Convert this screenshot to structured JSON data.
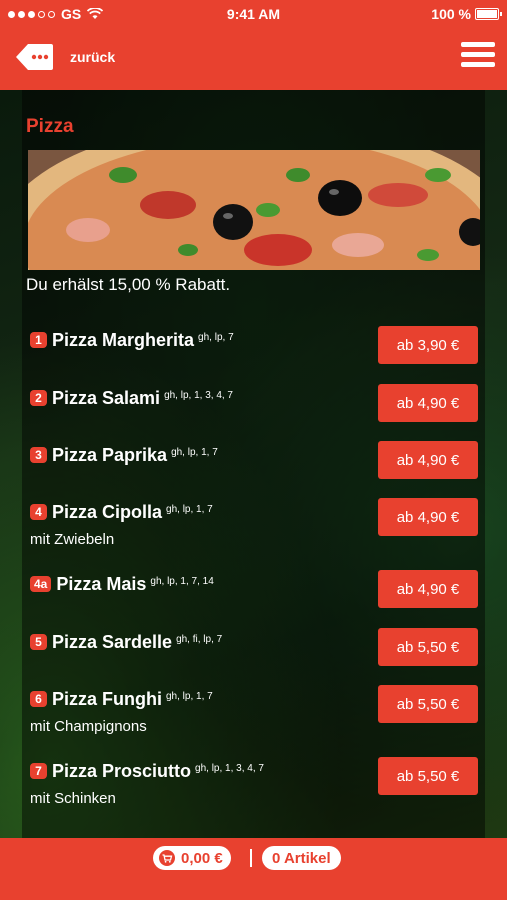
{
  "status_bar": {
    "carrier": "GS",
    "time": "9:41 AM",
    "battery": "100 %"
  },
  "nav": {
    "back_label": "zurück"
  },
  "section": {
    "title": "Pizza",
    "discount_text": "Du erhälst 15,00 % Rabatt."
  },
  "menu_items": [
    {
      "number": "1",
      "name": "Pizza Margherita",
      "allergens": "gh, lp, 7",
      "description": "",
      "price": "ab 3,90 €"
    },
    {
      "number": "2",
      "name": "Pizza Salami",
      "allergens": "gh, lp, 1, 3, 4, 7",
      "description": "",
      "price": "ab 4,90 €"
    },
    {
      "number": "3",
      "name": "Pizza Paprika",
      "allergens": "gh, lp, 1, 7",
      "description": "",
      "price": "ab 4,90 €"
    },
    {
      "number": "4",
      "name": "Pizza Cipolla",
      "allergens": "gh, lp, 1, 7",
      "description": "mit Zwiebeln",
      "price": "ab 4,90 €"
    },
    {
      "number": "4a",
      "name": "Pizza Mais",
      "allergens": "gh, lp, 1, 7, 14",
      "description": "",
      "price": "ab 4,90 €"
    },
    {
      "number": "5",
      "name": "Pizza Sardelle",
      "allergens": "gh, fi, lp, 7",
      "description": "",
      "price": "ab 5,50 €"
    },
    {
      "number": "6",
      "name": "Pizza Funghi",
      "allergens": "gh, lp, 1, 7",
      "description": "mit Champignons",
      "price": "ab 5,50 €"
    },
    {
      "number": "7",
      "name": "Pizza Prosciutto",
      "allergens": "gh, lp, 1, 3, 4, 7",
      "description": "mit Schinken",
      "price": "ab 5,50 €"
    }
  ],
  "footer": {
    "cart_total": "0,00 €",
    "article_count": "0 Artikel"
  },
  "colors": {
    "accent": "#e8412f"
  },
  "icons": {
    "back": "back-tag-icon",
    "menu": "hamburger-menu-icon",
    "cart": "cart-icon"
  }
}
